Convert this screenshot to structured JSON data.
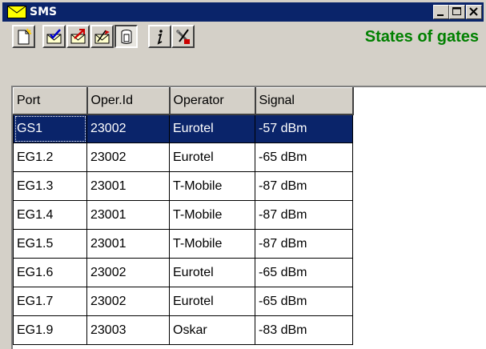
{
  "window": {
    "title": "SMS"
  },
  "toolbar": {
    "buttons": [
      {
        "icon": "new-document-icon"
      },
      {
        "icon": "mail-checked-icon"
      },
      {
        "icon": "mail-red-arrow-icon"
      },
      {
        "icon": "mail-flag-icon"
      },
      {
        "icon": "gate-status-icon",
        "pressed": true
      },
      {
        "icon": "info-icon"
      },
      {
        "icon": "tools-icon"
      }
    ],
    "label": "States of gates"
  },
  "colors": {
    "titlebar": "#0a246a",
    "selection": "#0a246a",
    "label": "#008000"
  },
  "table": {
    "headers": [
      "Port",
      "Oper.Id",
      "Operator",
      "Signal"
    ],
    "rows": [
      [
        "GS1",
        "23002",
        "Eurotel",
        "-57 dBm"
      ],
      [
        "EG1.2",
        "23002",
        "Eurotel",
        "-65 dBm"
      ],
      [
        "EG1.3",
        "23001",
        "T-Mobile",
        "-87 dBm"
      ],
      [
        "EG1.4",
        "23001",
        "T-Mobile",
        "-87 dBm"
      ],
      [
        "EG1.5",
        "23001",
        "T-Mobile",
        "-87 dBm"
      ],
      [
        "EG1.6",
        "23002",
        "Eurotel",
        "-65 dBm"
      ],
      [
        "EG1.7",
        "23002",
        "Eurotel",
        "-65 dBm"
      ],
      [
        "EG1.9",
        "23003",
        "Oskar",
        "-83 dBm"
      ]
    ],
    "selected_row": 0
  }
}
